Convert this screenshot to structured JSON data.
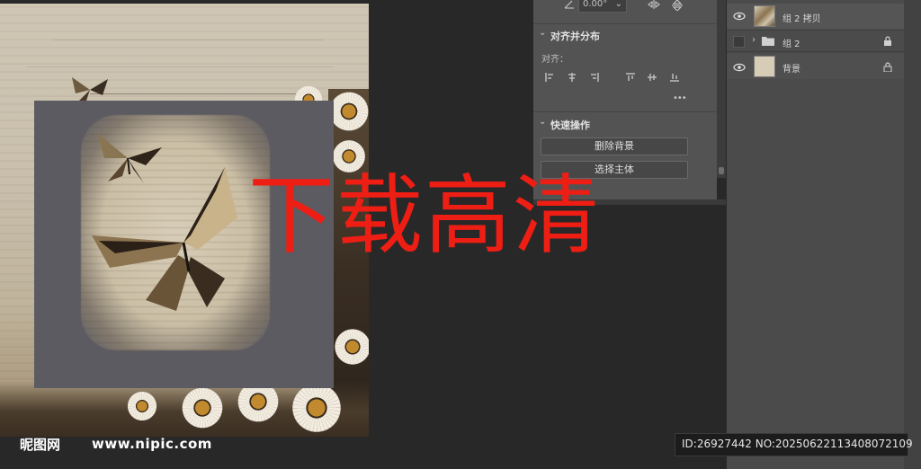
{
  "properties_panel": {
    "angle_value": "0.00°",
    "align_section": {
      "title": "对齐并分布",
      "align_label": "对齐：",
      "more_label": "•••"
    },
    "quick_actions": {
      "title": "快速操作",
      "remove_bg_label": "删除背景",
      "select_subject_label": "选择主体"
    }
  },
  "layers_panel": {
    "layers": [
      {
        "name": "组 2 拷贝",
        "visible": true,
        "locked": false
      },
      {
        "name": "组 2",
        "visible": false,
        "locked": true,
        "is_group": true
      },
      {
        "name": "背景",
        "visible": true,
        "locked": true
      }
    ]
  },
  "overlay": {
    "watermark": "下载高清",
    "logo_text": "昵图网",
    "logo_url": "www.nipic.com",
    "id_text": "ID:26927442 NO:20250622113408072109"
  },
  "colors": {
    "watermark": "#ee1e14",
    "panel_bg": "#535353",
    "app_bg": "#282828"
  }
}
